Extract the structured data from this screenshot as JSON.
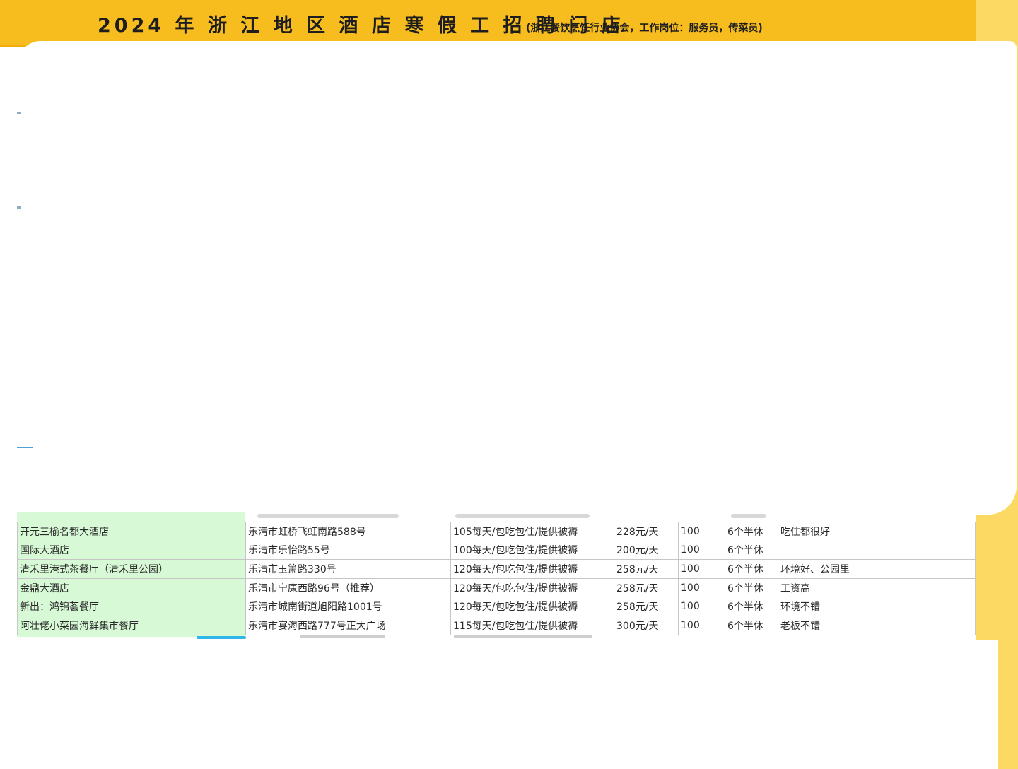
{
  "header": {
    "title": "2024 年 浙 江 地 区 酒 店 寒 假 工 招 聘 门 店",
    "subtitle": "(浙江餐饮烹饪行业协会，工作岗位：服务员，传菜员)"
  },
  "table": {
    "rows": [
      [
        "开元三榆名都大酒店",
        "乐清市虹桥飞虹南路588号",
        "105每天/包吃包住/提供被褥",
        "228元/天",
        "100",
        "6个半休",
        "吃住都很好"
      ],
      [
        "国际大酒店",
        "乐清市乐怡路55号",
        "100每天/包吃包住/提供被褥",
        "200元/天",
        "100",
        "6个半休",
        ""
      ],
      [
        "清禾里港式茶餐厅（清禾里公园）",
        "乐清市玉箫路330号",
        "120每天/包吃包住/提供被褥",
        "258元/天",
        "100",
        "6个半休",
        "环境好、公园里"
      ],
      [
        "金鼎大酒店",
        "乐清市宁康西路96号（推荐）",
        "120每天/包吃包住/提供被褥",
        "258元/天",
        "100",
        "6个半休",
        "工资高"
      ],
      [
        "新出：鸿锦荟餐厅",
        "乐清市城南街道旭阳路1001号",
        "120每天/包吃包住/提供被褥",
        "258元/天",
        "100",
        "6个半休",
        "环境不错"
      ],
      [
        "阿壮佬小菜园海鲜集市餐厅",
        "乐清市宴海西路777号正大广场",
        "115每天/包吃包住/提供被褥",
        "300元/天",
        "100",
        "6个半休",
        "老板不错"
      ]
    ]
  },
  "colors": {
    "banner": "#f7bd1e",
    "side_strip": "#fbd962",
    "name_cell_fill": "#d7f9d5",
    "grid_line": "#c6c6c6"
  }
}
